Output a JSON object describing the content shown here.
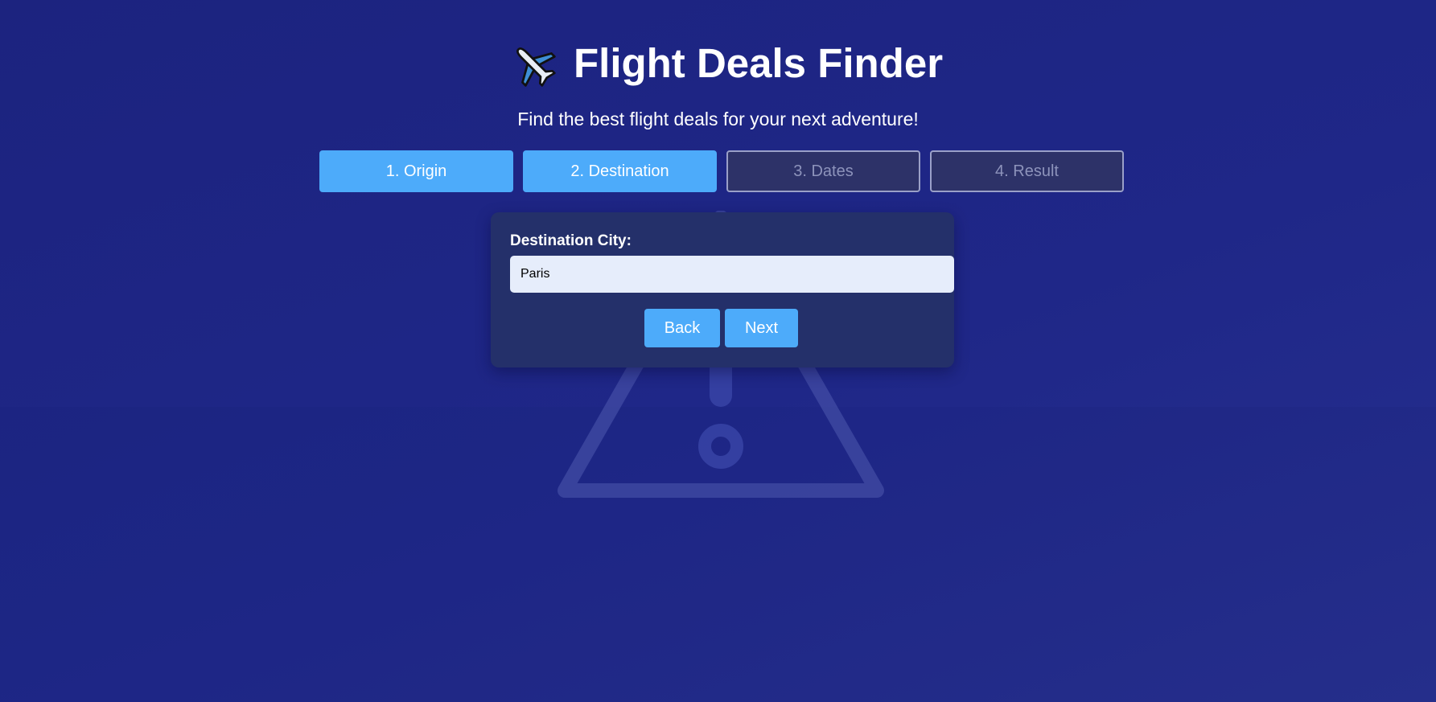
{
  "app": {
    "title": "Flight Deals Finder",
    "subtitle": "Find the best flight deals for your next adventure!",
    "title_icon": "airplane-icon"
  },
  "steps": [
    {
      "label": "1. Origin",
      "state": "completed"
    },
    {
      "label": "2. Destination",
      "state": "active"
    },
    {
      "label": "3. Dates",
      "state": "inactive"
    },
    {
      "label": "4. Result",
      "state": "inactive"
    }
  ],
  "form": {
    "label": "Destination City:",
    "value": "Paris",
    "back_label": "Back",
    "next_label": "Next"
  },
  "background_icon": "warning-triangle-icon",
  "colors": {
    "background": "#1f2788",
    "accent": "#4dabfa",
    "card": "#24306a",
    "input_background": "#e6edfb"
  }
}
